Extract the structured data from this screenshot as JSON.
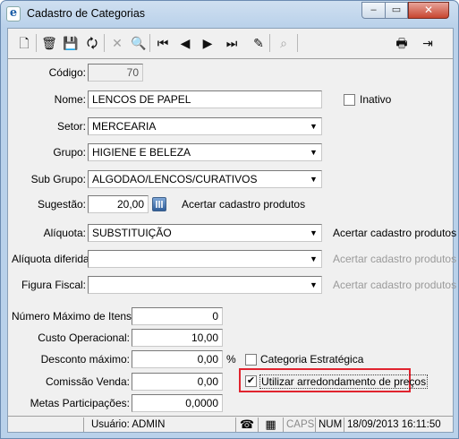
{
  "window": {
    "title": "Cadastro de Categorias",
    "app_icon_glyph": "e",
    "minimize_glyph": "‒",
    "maximize_glyph": "▭",
    "close_glyph": "✕"
  },
  "toolbar": [
    {
      "name": "new-icon",
      "glyph": "🗋",
      "enabled": true
    },
    {
      "name": "delete-icon",
      "glyph": "🗑",
      "enabled": true
    },
    {
      "name": "save-icon",
      "glyph": "💾",
      "enabled": false
    },
    {
      "name": "refresh-icon",
      "glyph": "🗘",
      "enabled": true
    },
    {
      "name": "cancel-icon",
      "glyph": "✕",
      "enabled": false
    },
    {
      "name": "search-icon",
      "glyph": "🔍",
      "enabled": true
    },
    {
      "name": "first-record-icon",
      "glyph": "⏮",
      "enabled": true
    },
    {
      "name": "previous-record-icon",
      "glyph": "◀",
      "enabled": true
    },
    {
      "name": "next-record-icon",
      "glyph": "▶",
      "enabled": true
    },
    {
      "name": "last-record-icon",
      "glyph": "⏭",
      "enabled": true
    },
    {
      "name": "clear-filter-icon",
      "glyph": "✎",
      "enabled": true
    },
    {
      "name": "binoculars-icon",
      "glyph": "⌕",
      "enabled": false
    },
    {
      "name": "print-icon",
      "glyph": "🖶",
      "enabled": true
    },
    {
      "name": "exit-icon",
      "glyph": "⇥",
      "enabled": true
    }
  ],
  "form": {
    "codigo": {
      "label": "Código:",
      "value": "70"
    },
    "nome": {
      "label": "Nome:",
      "value": "LENCOS DE PAPEL"
    },
    "inativo": {
      "label": "Inativo",
      "checked": false
    },
    "setor": {
      "label": "Setor:",
      "value": "MERCEARIA"
    },
    "grupo": {
      "label": "Grupo:",
      "value": "HIGIENE E BELEZA"
    },
    "sub_grupo": {
      "label": "Sub Grupo:",
      "value": "ALGODAO/LENCOS/CURATIVOS"
    },
    "sugestao": {
      "label": "Sugestão:",
      "value": "20,00",
      "action": "Acertar cadastro produtos"
    },
    "aliquota": {
      "label": "Alíquota:",
      "value": "SUBSTITUIÇÃO",
      "action": "Acertar cadastro produtos"
    },
    "aliquota_diferida": {
      "label": "Alíquota diferida:",
      "value": "",
      "action": "Acertar cadastro produtos"
    },
    "figura_fiscal": {
      "label": "Figura Fiscal:",
      "value": "",
      "action": "Acertar cadastro produtos"
    },
    "numero_maximo_itens": {
      "label": "Número Máximo de Itens:",
      "value": "0"
    },
    "custo_operacional": {
      "label": "Custo Operacional:",
      "value": "10,00"
    },
    "desconto_maximo": {
      "label": "Desconto máximo:",
      "value": "0,00",
      "unit": "%"
    },
    "categoria_estrategica": {
      "label": "Categoria Estratégica",
      "checked": false
    },
    "comissao_venda": {
      "label": "Comissão Venda:",
      "value": "0,00"
    },
    "utilizar_arredondamento": {
      "label": "Utilizar arredondamento de preços",
      "checked": true,
      "check_glyph": "✔"
    },
    "metas_participacoes": {
      "label": "Metas Participações:",
      "value": "0,0000"
    }
  },
  "statusbar": {
    "usuario": "Usuário: ADMIN",
    "phone_icon_glyph": "☎",
    "calc_icon_glyph": "▦",
    "caps": "CAPS",
    "num": "NUM",
    "datetime": "18/09/2013 16:11:50"
  },
  "colors": {
    "highlight_box": "#e0242f",
    "title_bar": "#b9d1ea",
    "disabled_text": "#9a9a9a"
  }
}
